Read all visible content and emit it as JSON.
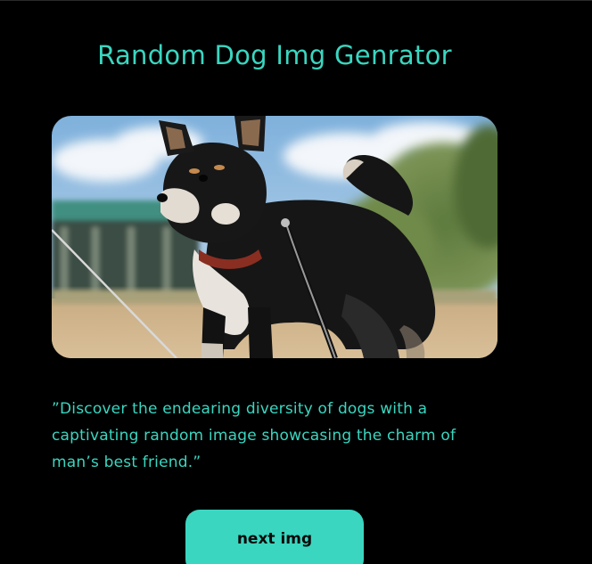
{
  "page": {
    "title": "Random Dog Img Genrator"
  },
  "image": {
    "alt": "Random dog image",
    "subject": "black and tan shiba inu on a leash"
  },
  "description": {
    "text": "”Discover the endearing diversity of dogs with a captivating random image showcasing the charm of man’s best friend.”"
  },
  "actions": {
    "next_label": "next img"
  },
  "theme": {
    "background": "#000000",
    "accent": "#3ad6c0",
    "button_text": "#0a0a0a"
  }
}
